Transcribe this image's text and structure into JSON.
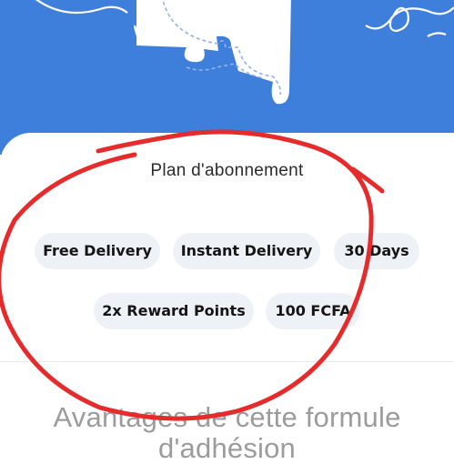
{
  "header": {
    "background_color": "#3f7fdc",
    "illustration": "puzzle-piece-icon"
  },
  "plan": {
    "title": "Plan d'abonnement",
    "chips": [
      "Free Delivery",
      "Instant Delivery",
      "30 Days",
      "2x Reward Points",
      "100 FCFA"
    ]
  },
  "benefits": {
    "title_line1": "Avantages de cette formule",
    "title_line2": "d'adhésion"
  },
  "annotation": {
    "shape": "hand-drawn-circle",
    "color": "#e52b2b"
  }
}
